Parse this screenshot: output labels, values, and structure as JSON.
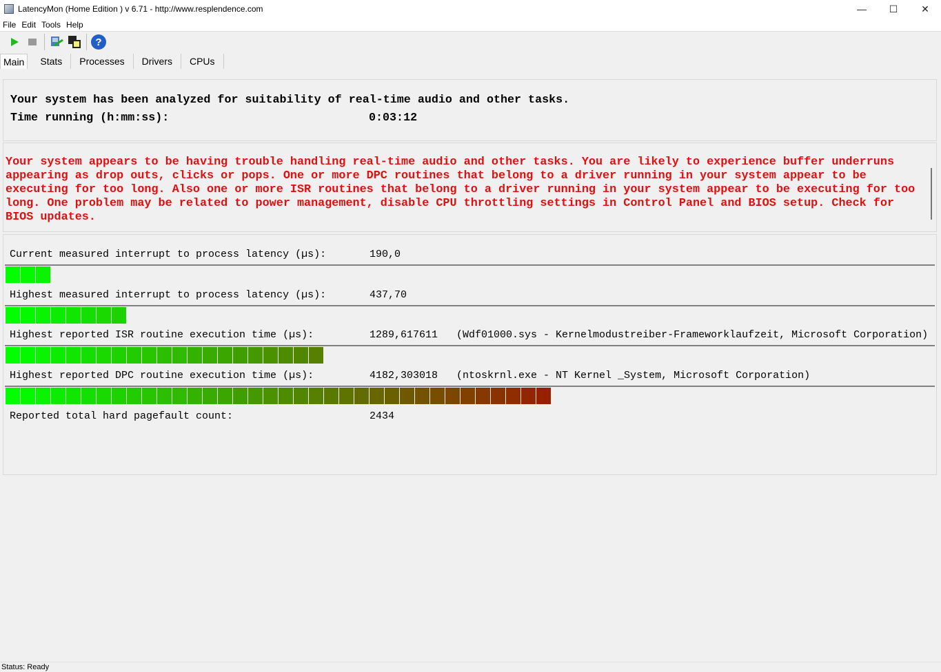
{
  "window": {
    "title": "LatencyMon  (Home Edition )  v 6.71 - http://www.resplendence.com",
    "minimize": "—",
    "maximize": "☐",
    "close": "✕"
  },
  "menu": [
    "File",
    "Edit",
    "Tools",
    "Help"
  ],
  "toolbar": {
    "icons": [
      "play-icon",
      "stop-icon",
      "tool-icon",
      "windows-icon",
      "help-icon"
    ]
  },
  "tabs": [
    "Main",
    "Stats",
    "Processes",
    "Drivers",
    "CPUs"
  ],
  "summary": {
    "line1": "Your system has been analyzed for suitability of real-time audio and other tasks.",
    "time_label": "Time running (h:mm:ss):",
    "time_value": "0:03:12"
  },
  "warning": "Your system appears to be having trouble handling real-time audio and other tasks. You are likely to experience buffer underruns appearing as drop outs, clicks or pops. One or more DPC routines that belong to a driver running in your system appear to be executing for too long. Also one or more ISR routines that belong to a driver running in your system appear to be executing for too long. One problem may be related to power management, disable CPU throttling settings in Control Panel and BIOS setup. Check for BIOS updates.",
  "metrics": [
    {
      "label": "Current measured interrupt to process latency (µs):",
      "value": "190,0",
      "segments": 3
    },
    {
      "label": "Highest measured interrupt to process latency (µs):",
      "value": "437,70",
      "segments": 8
    },
    {
      "label": "Highest reported ISR routine execution time (µs):",
      "value": "1289,617611   (Wdf01000.sys - Kernelmodustreiber-Frameworklaufzeit, Microsoft Corporation)",
      "segments": 21
    },
    {
      "label": "Highest reported DPC routine execution time (µs):",
      "value": "4182,303018   (ntoskrnl.exe - NT Kernel _System, Microsoft Corporation)",
      "segments": 36
    }
  ],
  "pagefault": {
    "label": "Reported total hard pagefault count:",
    "value": "2434"
  },
  "bar_colors": {
    "start": "#00ff00",
    "end": "#962000"
  },
  "status": "Status: Ready"
}
